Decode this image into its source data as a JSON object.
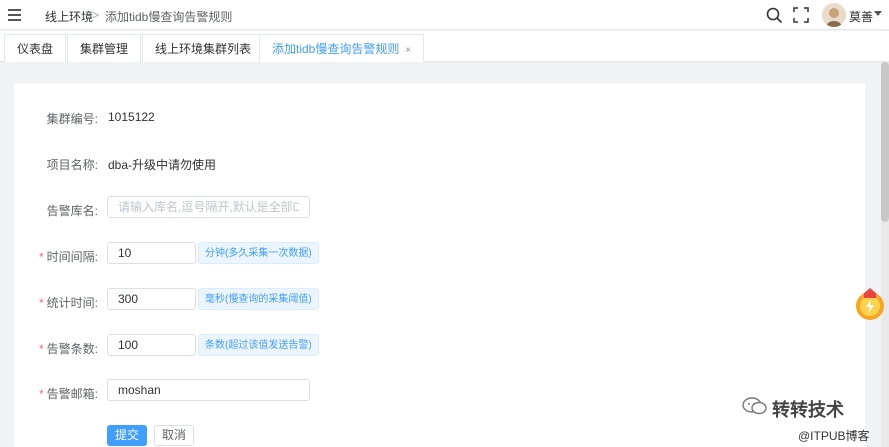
{
  "header": {
    "breadcrumb_home": "线上环境",
    "breadcrumb_sep": ">",
    "breadcrumb_current": "添加tidb慢查询告警规则",
    "username": "莫善"
  },
  "tabs": [
    {
      "label": "仪表盘"
    },
    {
      "label": "集群管理"
    },
    {
      "label": "线上环境集群列表"
    },
    {
      "label": "添加tidb慢查询告警规则",
      "active": true,
      "close": "×"
    }
  ],
  "form": {
    "cluster_id": {
      "label": "集群编号:",
      "value": "1015122"
    },
    "project_name": {
      "label": "项目名称:",
      "value": "dba-升级中请勿使用"
    },
    "db_name": {
      "label": "告警库名:",
      "placeholder": "请输入库名,逗号隔开,默认是全部DB"
    },
    "interval": {
      "label": "时间间隔:",
      "value": "10",
      "hint": "分钟(多久采集一次数据)"
    },
    "stat_time": {
      "label": "统计时间:",
      "value": "300",
      "hint": "毫秒(慢查询的采集阈值)"
    },
    "alert_count": {
      "label": "告警条数:",
      "value": "100",
      "hint": "条数(超过该值发送告警)"
    },
    "alert_email": {
      "label": "告警邮箱:",
      "value": "moshan"
    },
    "required_mark": "*",
    "submit_label": "提交",
    "cancel_label": "取消"
  },
  "watermark": {
    "main": "转转技术",
    "sub": "@ITPUB博客"
  },
  "colors": {
    "accent": "#409eff",
    "required": "#f56c6c",
    "hint_bg": "#ecf5ff"
  },
  "icons": [
    "hamburger-icon",
    "search-icon",
    "fullscreen-icon",
    "chevron-down-icon",
    "close-icon",
    "wechat-icon"
  ]
}
